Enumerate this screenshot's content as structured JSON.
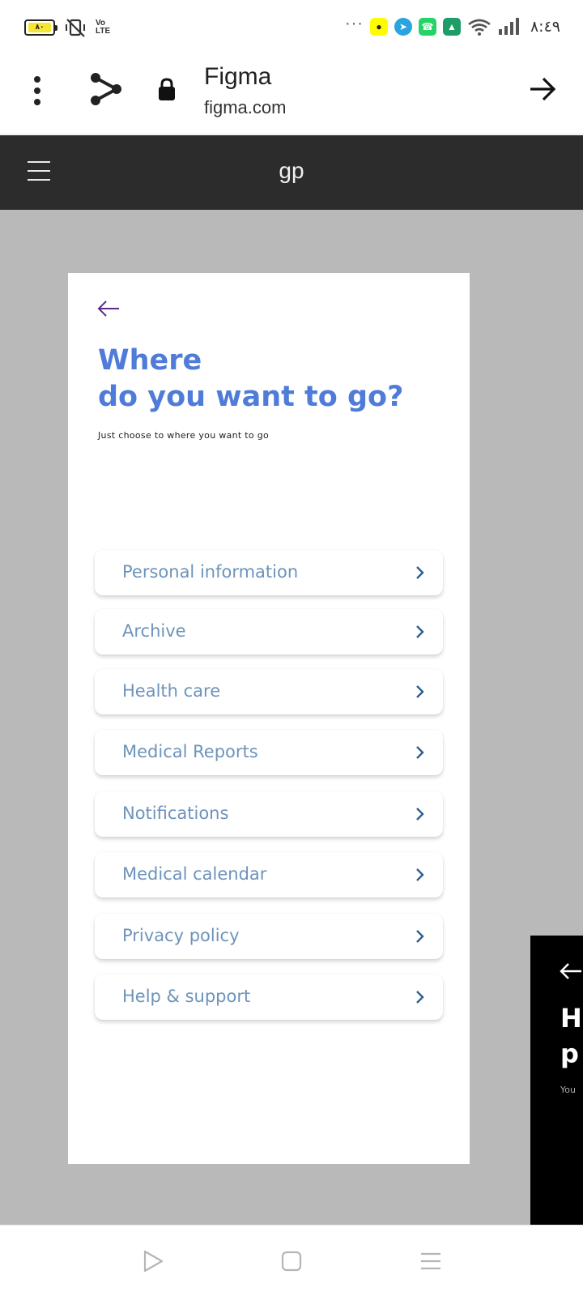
{
  "status_bar": {
    "battery_level": "٨٠",
    "volte": [
      "Vo",
      "LTE"
    ],
    "time": "٨:٤٩",
    "overflow": "···",
    "icons": [
      "battery-icon",
      "vibrate-icon",
      "snapchat-icon",
      "telegram-icon",
      "whatsapp-icon",
      "mountain-app-icon",
      "wifi-icon",
      "signal-icon"
    ]
  },
  "browser": {
    "title": "Figma",
    "url": "figma.com"
  },
  "figma": {
    "file_name": "gp"
  },
  "screen": {
    "heading_line1": "Where",
    "heading_line2": "do you want to go?",
    "subtext": "Just choose to where you want to go",
    "accent_color": "#4f7bd9",
    "item_text_color": "#6d93bb",
    "chevron_color": "#2d5f93",
    "items": [
      {
        "label": "Personal information"
      },
      {
        "label": "Archive"
      },
      {
        "label": "Health care"
      },
      {
        "label": "Medical Reports"
      },
      {
        "label": "Notifications"
      },
      {
        "label": "Medical calendar"
      },
      {
        "label": "Privacy policy"
      },
      {
        "label": "Help & support"
      }
    ]
  },
  "peek_screen": {
    "heading": "H\np",
    "subtext": "You"
  }
}
